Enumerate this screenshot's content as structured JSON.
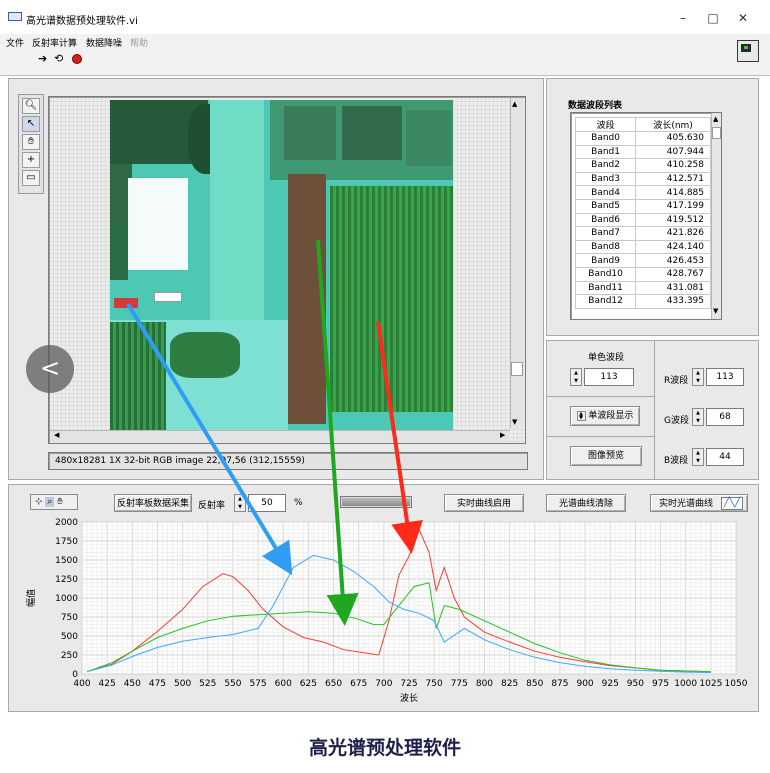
{
  "window": {
    "title": "高光谱数据预处理软件.vi",
    "minimize": "–",
    "maximize": "□",
    "close": "✕"
  },
  "menu": [
    "文件",
    "反射率计算",
    "数据降噪",
    "帮助"
  ],
  "toolbar": {
    "run_icon": "run-arrow-icon",
    "run_continuous_icon": "run-continuously-icon",
    "abort_icon": "abort-icon"
  },
  "image_panel": {
    "status": "480x18281 1X 32-bit RGB image 22,97,56      (312,15559)"
  },
  "band_list": {
    "title": "数据波段列表",
    "headers": [
      "波段",
      "波长(nm)"
    ],
    "rows": [
      [
        "Band0",
        "405.630"
      ],
      [
        "Band1",
        "407.944"
      ],
      [
        "Band2",
        "410.258"
      ],
      [
        "Band3",
        "412.571"
      ],
      [
        "Band4",
        "414.885"
      ],
      [
        "Band5",
        "417.199"
      ],
      [
        "Band6",
        "419.512"
      ],
      [
        "Band7",
        "421.826"
      ],
      [
        "Band8",
        "424.140"
      ],
      [
        "Band9",
        "426.453"
      ],
      [
        "Band10",
        "428.767"
      ],
      [
        "Band11",
        "431.081"
      ],
      [
        "Band12",
        "433.395"
      ]
    ]
  },
  "single_band": {
    "label": "单色波段",
    "value": "113",
    "show_button": "单波段显示"
  },
  "preview_button": "图像预览",
  "rgb": {
    "r_label": "R波段",
    "r_value": "113",
    "g_label": "G波段",
    "g_value": "68",
    "b_label": "B波段",
    "b_value": "44"
  },
  "bottom_toolbar": {
    "collect_button": "反射率板数据采集",
    "reflect_label": "反射率",
    "reflect_value": "50",
    "unit": "%",
    "realtime_enable_button": "实时曲线启用",
    "clear_button": "光谱曲线清除",
    "realtime_label": "实时光谱曲线"
  },
  "caption": "高光谱预处理软件",
  "colors": {
    "red": "#ff3b30",
    "green": "#22c322",
    "blue": "#3ba9ff",
    "arrow_red": "#ff2a1a",
    "arrow_green": "#1fa81f",
    "arrow_blue": "#2f9df5"
  },
  "chart_data": {
    "type": "line",
    "xlabel": "波长",
    "ylabel": "幅值",
    "xlim": [
      400,
      1050
    ],
    "ylim": [
      0,
      2000
    ],
    "xticks": [
      400,
      425,
      450,
      475,
      500,
      525,
      550,
      575,
      600,
      625,
      650,
      675,
      700,
      725,
      750,
      775,
      800,
      825,
      850,
      875,
      900,
      925,
      950,
      975,
      1000,
      1025,
      1050
    ],
    "yticks": [
      0,
      250,
      500,
      750,
      1000,
      1250,
      1500,
      1750,
      2000
    ],
    "grid": true,
    "series": [
      {
        "color": "red",
        "x": [
          405,
          430,
          450,
          475,
          500,
          520,
          540,
          550,
          565,
          580,
          600,
          620,
          640,
          660,
          680,
          695,
          705,
          715,
          725,
          735,
          745,
          752,
          760,
          770,
          780,
          800,
          825,
          850,
          875,
          900,
          925,
          950,
          975,
          1000,
          1025
        ],
        "y": [
          30,
          130,
          300,
          560,
          850,
          1150,
          1320,
          1280,
          1100,
          850,
          620,
          480,
          420,
          320,
          280,
          250,
          700,
          1300,
          1550,
          1900,
          1600,
          1100,
          1400,
          1000,
          750,
          550,
          420,
          300,
          220,
          160,
          110,
          80,
          50,
          40,
          30
        ]
      },
      {
        "color": "green",
        "x": [
          405,
          430,
          450,
          475,
          500,
          525,
          550,
          575,
          600,
          625,
          650,
          675,
          690,
          700,
          715,
          730,
          745,
          752,
          760,
          775,
          800,
          825,
          850,
          875,
          900,
          925,
          950,
          975,
          1000,
          1025
        ],
        "y": [
          30,
          150,
          300,
          480,
          600,
          700,
          760,
          780,
          800,
          820,
          800,
          720,
          650,
          650,
          900,
          1150,
          1200,
          600,
          900,
          850,
          700,
          550,
          400,
          280,
          180,
          120,
          80,
          50,
          40,
          30
        ]
      },
      {
        "color": "blue",
        "x": [
          405,
          430,
          450,
          475,
          500,
          525,
          550,
          575,
          590,
          610,
          630,
          650,
          670,
          690,
          705,
          720,
          735,
          750,
          760,
          780,
          800,
          825,
          850,
          875,
          900,
          925,
          950,
          975,
          1000,
          1025
        ],
        "y": [
          30,
          120,
          230,
          350,
          430,
          480,
          520,
          600,
          900,
          1400,
          1560,
          1500,
          1350,
          1150,
          950,
          850,
          800,
          700,
          420,
          600,
          450,
          320,
          220,
          150,
          100,
          70,
          50,
          35,
          25,
          20
        ]
      }
    ]
  }
}
